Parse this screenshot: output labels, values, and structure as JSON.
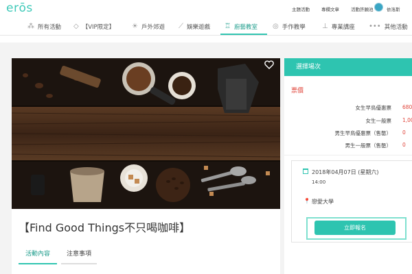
{
  "header": {
    "logo": "erōs",
    "links": [
      "主題活動",
      "專欄文章",
      "活動許願池"
    ],
    "username": "依洛斯"
  },
  "nav": {
    "items": [
      {
        "icon": "dots-icon",
        "glyph": "⁂",
        "label": "所有活動"
      },
      {
        "icon": "diamond-icon",
        "glyph": "◇",
        "label": "【VIP限定】"
      },
      {
        "icon": "sun-icon",
        "glyph": "☀",
        "label": "戶外郊遊"
      },
      {
        "icon": "wand-icon",
        "glyph": "⟋",
        "label": "娛樂遊戲"
      },
      {
        "icon": "chef-hat-icon",
        "glyph": "♖",
        "label": "廚藝教室"
      },
      {
        "icon": "yarn-icon",
        "glyph": "◎",
        "label": "手作教學"
      },
      {
        "icon": "lectern-icon",
        "glyph": "⊥",
        "label": "專業講座"
      },
      {
        "icon": "more-icon",
        "glyph": "•••",
        "label": "其他活動"
      }
    ],
    "active_index": 4
  },
  "event": {
    "title": "【Find Good Things不只喝咖啡】",
    "tabs": [
      "活動內容",
      "注意事項"
    ]
  },
  "panel": {
    "header": "選擇場次",
    "price_label": "票價",
    "prices": [
      {
        "label": "女生早鳥優惠票",
        "value": "680"
      },
      {
        "label": "女生一般票",
        "value": "1,00"
      },
      {
        "label": "男生早鳥優惠票（售罄）",
        "value": "0"
      },
      {
        "label": "男生一般票（售罄）",
        "value": "0"
      }
    ],
    "date": "2018年04月07日 (星期六)",
    "time": "14:00",
    "venue": "戀愛大學",
    "signup": "立即報名"
  },
  "colors": {
    "accent": "#2ec4b0",
    "price": "#e0453b"
  }
}
